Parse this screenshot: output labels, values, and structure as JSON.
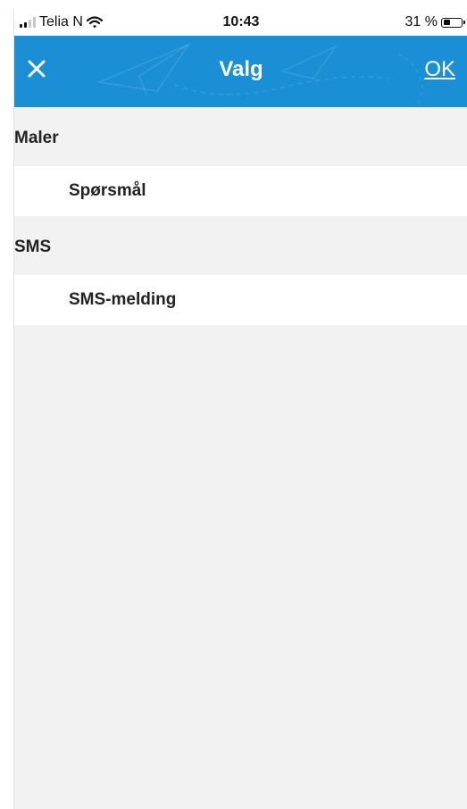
{
  "status_bar": {
    "carrier": "Telia N",
    "time": "10:43",
    "battery_percent": "31 %",
    "battery_level": 0.31
  },
  "nav": {
    "title": "Valg",
    "ok_label": "OK",
    "close_icon": "close-icon",
    "background_color": "#1a8fd6"
  },
  "sections": [
    {
      "header": "Maler",
      "items": [
        {
          "label": "Spørsmål"
        }
      ]
    },
    {
      "header": "SMS",
      "items": [
        {
          "label": "SMS-melding"
        }
      ]
    }
  ]
}
